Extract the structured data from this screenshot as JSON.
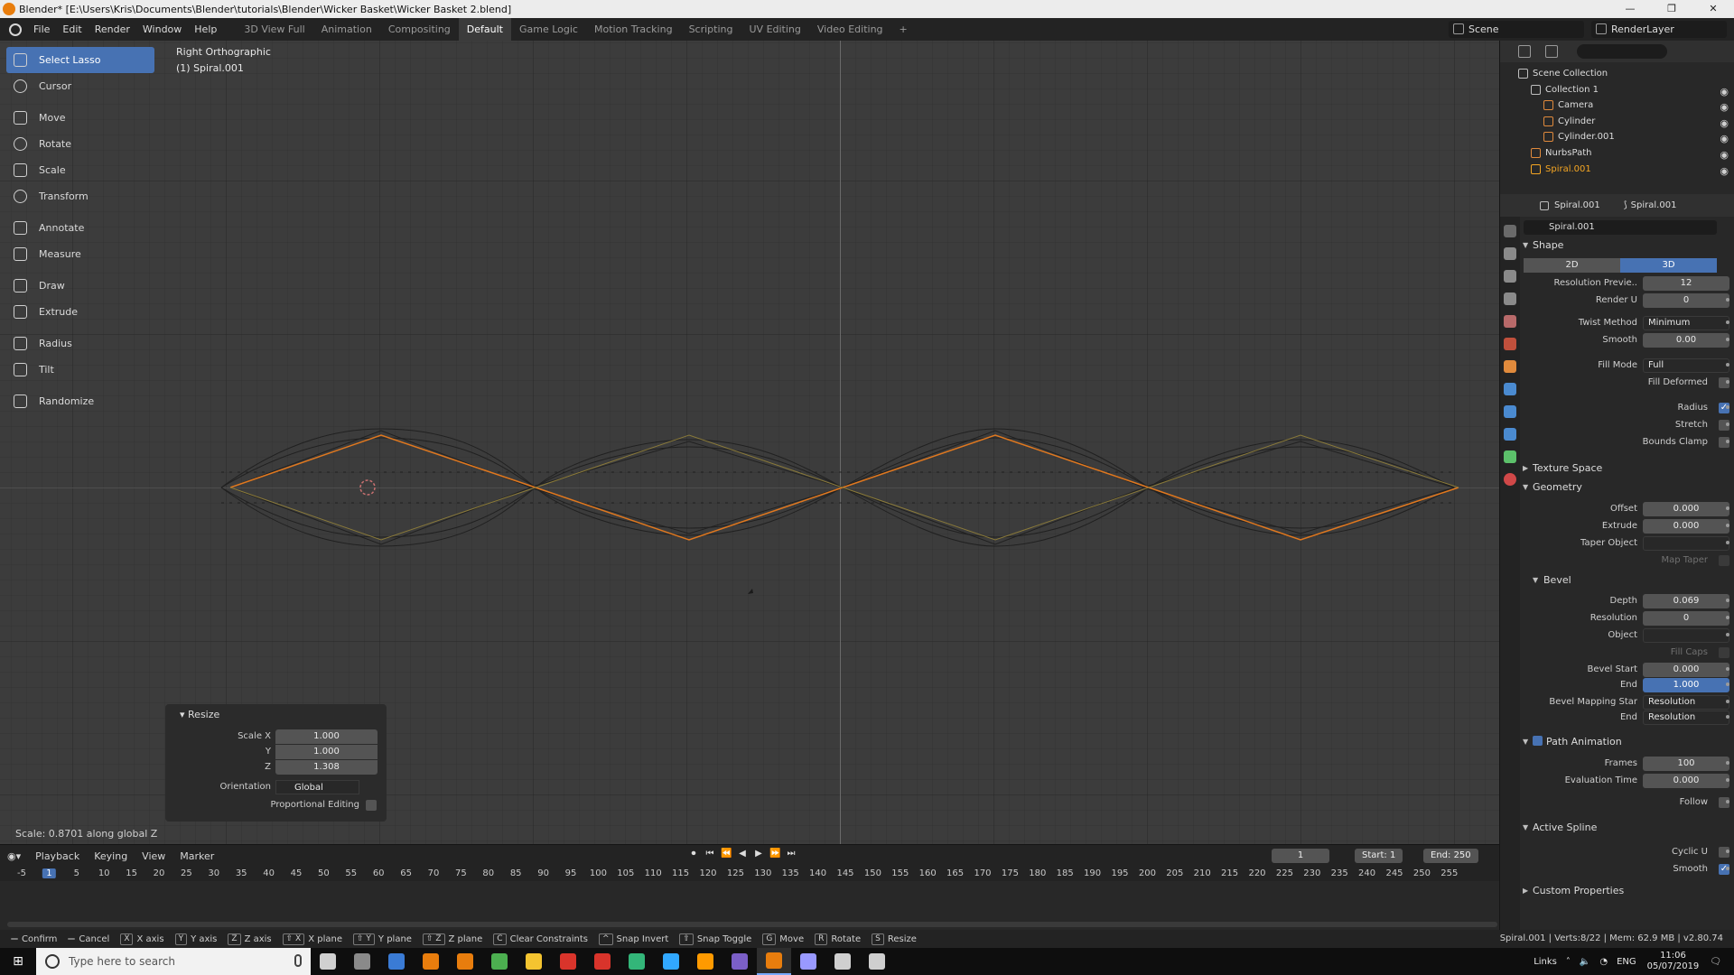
{
  "window": {
    "title": "Blender* [E:\\Users\\Kris\\Documents\\Blender\\tutorials\\Blender\\Wicker Basket\\Wicker Basket 2.blend]",
    "controls": [
      "—",
      "❐",
      "✕"
    ]
  },
  "menu": [
    "File",
    "Edit",
    "Render",
    "Window",
    "Help"
  ],
  "workspaces": [
    "3D View Full",
    "Animation",
    "Compositing",
    "Default",
    "Game Logic",
    "Motion Tracking",
    "Scripting",
    "UV Editing",
    "Video Editing"
  ],
  "active_workspace": "Default",
  "add_workspace": "+",
  "scene": "Scene",
  "render_layer": "RenderLayer",
  "viewport": {
    "view_name": "Right Orthographic",
    "object_name": "(1) Spiral.001",
    "status": "Scale: 0.8701 along global Z"
  },
  "tools": [
    {
      "label": "Select Lasso",
      "icon": "lasso-select-icon",
      "active": true
    },
    {
      "label": "Cursor",
      "icon": "cursor-icon"
    },
    {
      "label": "Move",
      "icon": "move-icon"
    },
    {
      "label": "Rotate",
      "icon": "rotate-icon"
    },
    {
      "label": "Scale",
      "icon": "scale-icon"
    },
    {
      "label": "Transform",
      "icon": "transform-icon"
    },
    {
      "label": "Annotate",
      "icon": "annotate-icon"
    },
    {
      "label": "Measure",
      "icon": "measure-icon"
    },
    {
      "label": "Draw",
      "icon": "draw-icon"
    },
    {
      "label": "Extrude",
      "icon": "extrude-icon"
    },
    {
      "label": "Radius",
      "icon": "radius-icon"
    },
    {
      "label": "Tilt",
      "icon": "tilt-icon"
    },
    {
      "label": "Randomize",
      "icon": "randomize-icon"
    }
  ],
  "resize_panel": {
    "title": "Resize",
    "scale_x_label": "Scale X",
    "scale_x": "1.000",
    "y_label": "Y",
    "scale_y": "1.000",
    "z_label": "Z",
    "scale_z": "1.308",
    "orientation_label": "Orientation",
    "orientation": "Global",
    "proportional_label": "Proportional Editing"
  },
  "timeline": {
    "menus": [
      "Playback",
      "Keying",
      "View",
      "Marker"
    ],
    "current_frame": "1",
    "start_label": "Start:",
    "start": "1",
    "end_label": "End:",
    "end": "250",
    "ruler": [
      "-5",
      "1",
      "5",
      "10",
      "15",
      "20",
      "25",
      "30",
      "35",
      "40",
      "45",
      "50",
      "55",
      "60",
      "65",
      "70",
      "75",
      "80",
      "85",
      "90",
      "95",
      "100",
      "105",
      "110",
      "115",
      "120",
      "125",
      "130",
      "135",
      "140",
      "145",
      "150",
      "155",
      "160",
      "165",
      "170",
      "175",
      "180",
      "185",
      "190",
      "195",
      "200",
      "205",
      "210",
      "215",
      "220",
      "225",
      "230",
      "235",
      "240",
      "245",
      "250",
      "255"
    ],
    "controls": [
      "⏺",
      "⏮",
      "⏪",
      "◀",
      "▶",
      "⏩",
      "⏭"
    ]
  },
  "statusbar": {
    "items": [
      {
        "key": "",
        "label": "Confirm"
      },
      {
        "key": "",
        "label": "Cancel"
      },
      {
        "key": "X",
        "label": "X axis"
      },
      {
        "key": "Y",
        "label": "Y axis"
      },
      {
        "key": "Z",
        "label": "Z axis"
      },
      {
        "key": "⇧ X",
        "label": "X plane"
      },
      {
        "key": "⇧ Y",
        "label": "Y plane"
      },
      {
        "key": "⇧ Z",
        "label": "Z plane"
      },
      {
        "key": "C",
        "label": "Clear Constraints"
      },
      {
        "key": "^",
        "label": "Snap Invert"
      },
      {
        "key": "⇧",
        "label": "Snap Toggle"
      },
      {
        "key": "G",
        "label": "Move"
      },
      {
        "key": "R",
        "label": "Rotate"
      },
      {
        "key": "S",
        "label": "Resize"
      }
    ],
    "stats": "Spiral.001 | Verts:8/22 | Mem: 62.9 MB | v2.80.74"
  },
  "outliner": {
    "rows": [
      {
        "name": "Scene Collection",
        "icon": "scene-collection-icon",
        "color": "#bfbfbf"
      },
      {
        "name": "Collection 1",
        "icon": "collection-icon",
        "color": "#bfbfbf"
      },
      {
        "name": "Camera",
        "icon": "camera-icon",
        "color": "#e08a3c"
      },
      {
        "name": "Cylinder",
        "icon": "mesh-icon",
        "color": "#e08a3c"
      },
      {
        "name": "Cylinder.001",
        "icon": "mesh-icon",
        "color": "#e08a3c"
      },
      {
        "name": "NurbsPath",
        "icon": "curve-icon",
        "color": "#e08a3c"
      },
      {
        "name": "Spiral.001",
        "icon": "curve-icon",
        "color": "#f5a623",
        "selected": true
      }
    ]
  },
  "properties": {
    "object": "Spiral.001",
    "data": "Spiral.001",
    "datablock": "Spiral.001",
    "sections": {
      "shape": "Shape",
      "texture_space": "Texture Space",
      "geometry": "Geometry",
      "bevel": "Bevel",
      "path_animation": "Path Animation",
      "active_spline": "Active Spline",
      "custom_properties": "Custom Properties"
    },
    "dims": [
      "2D",
      "3D"
    ],
    "resolution_preview_label": "Resolution Previe..",
    "resolution_preview": "12",
    "render_u_label": "Render U",
    "render_u": "0",
    "twist_method_label": "Twist Method",
    "twist_method": "Minimum",
    "smooth_label": "Smooth",
    "smooth": "0.00",
    "fill_mode_label": "Fill Mode",
    "fill_mode": "Full",
    "fill_deformed_label": "Fill Deformed",
    "radius_label": "Radius",
    "stretch_label": "Stretch",
    "bounds_clamp_label": "Bounds Clamp",
    "offset_label": "Offset",
    "offset": "0.000",
    "extrude_label": "Extrude",
    "extrude": "0.000",
    "taper_object_label": "Taper Object",
    "map_taper_label": "Map Taper",
    "depth_label": "Depth",
    "depth": "0.069",
    "bevel_resolution_label": "Resolution",
    "bevel_resolution": "0",
    "bevel_object_label": "Object",
    "fill_caps_label": "Fill Caps",
    "bevel_start_label": "Bevel Start",
    "bevel_start": "0.000",
    "bevel_end_label": "End",
    "bevel_end": "1.000",
    "bevel_mapping_start_label": "Bevel Mapping Star",
    "bevel_mapping_start": "Resolution",
    "bevel_mapping_end_label": "End",
    "bevel_mapping_end": "Resolution",
    "frames_label": "Frames",
    "frames": "100",
    "evaluation_time_label": "Evaluation Time",
    "evaluation_time": "0.000",
    "follow_label": "Follow",
    "cyclic_u_label": "Cyclic U",
    "spline_smooth_label": "Smooth"
  },
  "taskbar": {
    "search_placeholder": "Type here to search",
    "apps": [
      {
        "name": "task-view-icon",
        "color": "#d0d0d0"
      },
      {
        "name": "calculator-icon",
        "color": "#8a8a8a"
      },
      {
        "name": "app-icon",
        "color": "#3a7bd5"
      },
      {
        "name": "blender-icon",
        "color": "#e87d0d"
      },
      {
        "name": "blender-icon",
        "color": "#e87d0d"
      },
      {
        "name": "chrome-icon",
        "color": "#4caf50"
      },
      {
        "name": "file-explorer-icon",
        "color": "#f4c430"
      },
      {
        "name": "app-icon",
        "color": "#d9342b"
      },
      {
        "name": "app-icon",
        "color": "#d9342b"
      },
      {
        "name": "play-store-icon",
        "color": "#33b679"
      },
      {
        "name": "photoshop-icon",
        "color": "#31a8ff"
      },
      {
        "name": "illustrator-icon",
        "color": "#ff9a00"
      },
      {
        "name": "app-icon",
        "color": "#7b5fc7"
      },
      {
        "name": "blender-icon",
        "color": "#e87d0d",
        "active": true
      },
      {
        "name": "premiere-icon",
        "color": "#9999ff"
      },
      {
        "name": "photos-icon",
        "color": "#cfcfcf"
      },
      {
        "name": "app-icon",
        "color": "#cfcfcf"
      }
    ],
    "tray_links": "Links",
    "lang": "ENG",
    "time": "11:06",
    "date": "05/07/2019"
  }
}
